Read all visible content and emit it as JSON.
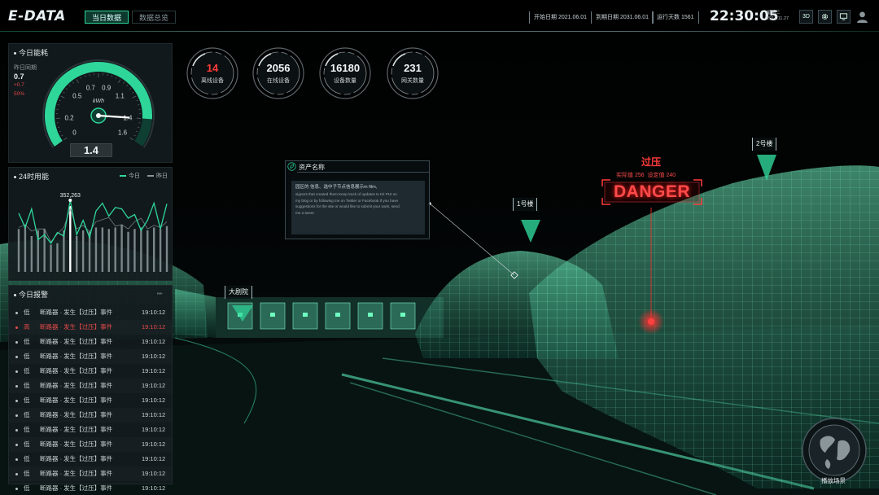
{
  "header": {
    "logo": "E-DATA",
    "tabs": [
      {
        "label": "当日数据",
        "active": true
      },
      {
        "label": "数据总览",
        "active": false
      }
    ],
    "start_date": "开始日期 2021.06.01",
    "end_date": "到期日期 2031.06.01",
    "run_days": "运行天数 1561",
    "clock": "22:30:05",
    "weekday": "星期三",
    "date": "2017.11.27",
    "btn_3d": "3D"
  },
  "energy": {
    "title": "今日能耗",
    "compare_label": "昨日同期",
    "compare_value": "0.7",
    "compare_delta": "+0.7",
    "compare_pct": "50%",
    "gauge_ticks": [
      "0",
      "0.2",
      "0.5",
      "0.7",
      "0.9",
      "1.1",
      "1.4",
      "1.6"
    ],
    "gauge_unit": "kWh",
    "gauge_value": 1.4,
    "gauge_max": 1.6,
    "readout": "1.4"
  },
  "hourly": {
    "title": "24时用能",
    "legend_today": "今日",
    "legend_yesterday": "昨日",
    "peak_label": "352,263",
    "peak_index": 8
  },
  "chart_data": {
    "type": "bar",
    "title": "24时用能",
    "series": [
      {
        "name": "今日",
        "values": [
          0.82,
          0.62,
          0.88,
          0.45,
          0.52,
          0.4,
          0.55,
          0.5,
          1.0,
          0.52,
          0.72,
          0.48,
          0.85,
          0.96,
          0.78,
          0.9,
          0.88,
          0.75,
          0.8,
          0.58,
          0.72,
          0.96,
          0.6,
          0.95
        ]
      },
      {
        "name": "昨日",
        "values": [
          0.62,
          0.66,
          0.57,
          0.6,
          0.6,
          0.42,
          0.53,
          0.62,
          0.88,
          0.6,
          0.65,
          0.56,
          0.7,
          0.73,
          0.76,
          0.64,
          0.66,
          0.6,
          0.7,
          0.75,
          0.6,
          0.65,
          0.62,
          0.7
        ]
      }
    ],
    "bars": [
      0.6,
      0.66,
      0.5,
      0.58,
      0.6,
      0.38,
      0.4,
      0.58,
      0.92,
      0.5,
      0.58,
      0.56,
      0.62,
      0.62,
      0.6,
      0.62,
      0.66,
      0.56,
      0.6,
      0.62,
      0.58,
      0.62,
      0.6,
      0.64
    ],
    "ylim": [
      0,
      1
    ],
    "grid": false,
    "legend": "top-right"
  },
  "alarms": {
    "title": "今日报警",
    "arrows": "▸▸▸",
    "rows": [
      {
        "level": "低",
        "message": "断路器 · 发生【过压】事件",
        "time": "19:10:12",
        "hot": false
      },
      {
        "level": "高",
        "message": "断路器 · 发生【过压】事件",
        "time": "19:10:12",
        "hot": true
      },
      {
        "level": "低",
        "message": "断路器 · 发生【过压】事件",
        "time": "19:10:12",
        "hot": false
      },
      {
        "level": "低",
        "message": "断路器 · 发生【过压】事件",
        "time": "19:10:12",
        "hot": false
      },
      {
        "level": "低",
        "message": "断路器 · 发生【过压】事件",
        "time": "19:10:12",
        "hot": false
      },
      {
        "level": "低",
        "message": "断路器 · 发生【过压】事件",
        "time": "19:10:12",
        "hot": false
      },
      {
        "level": "低",
        "message": "断路器 · 发生【过压】事件",
        "time": "19:10:12",
        "hot": false
      },
      {
        "level": "低",
        "message": "断路器 · 发生【过压】事件",
        "time": "19:10:12",
        "hot": false
      },
      {
        "level": "低",
        "message": "断路器 · 发生【过压】事件",
        "time": "19:10:12",
        "hot": false
      },
      {
        "level": "低",
        "message": "断路器 · 发生【过压】事件",
        "time": "19:10:12",
        "hot": false
      },
      {
        "level": "低",
        "message": "断路器 · 发生【过压】事件",
        "time": "19:10:12",
        "hot": false
      },
      {
        "level": "低",
        "message": "断路器 · 发生【过压】事件",
        "time": "19:10:12",
        "hot": false
      },
      {
        "level": "低",
        "message": "断路器 · 发生【过压】事件",
        "time": "19:10:12",
        "hot": false
      }
    ]
  },
  "stats": [
    {
      "value": "14",
      "label": "离线设备",
      "color": "#ff3b3b"
    },
    {
      "value": "2056",
      "label": "在线设备",
      "color": "#f2f6f7"
    },
    {
      "value": "16180",
      "label": "设备数量",
      "color": "#f2f6f7"
    },
    {
      "value": "231",
      "label": "网关数量",
      "color": "#f2f6f7"
    }
  ],
  "asset": {
    "title": "资产名称",
    "line1": "园区的 信息、选中子节点信息展示m film,",
    "line2": "signers that created them.Keep track of updates to Kit PUI on",
    "line3": "my blog or by following me on Twitter or Facebook.If you have",
    "line4": "suggestions for the site or would like to submit your work, send",
    "line5": "me a tweet."
  },
  "tags": {
    "theater": "大剧院",
    "building1": "1号楼",
    "building2": "2号楼"
  },
  "danger": {
    "title": "过压",
    "actual": "实际值 256",
    "setpoint": "设定值 240",
    "word": "DANGER"
  },
  "replay": {
    "label": "播放场景"
  },
  "colors": {
    "accent": "#2fd69a",
    "danger": "#ff3b3b",
    "panel": "#141b1e"
  }
}
